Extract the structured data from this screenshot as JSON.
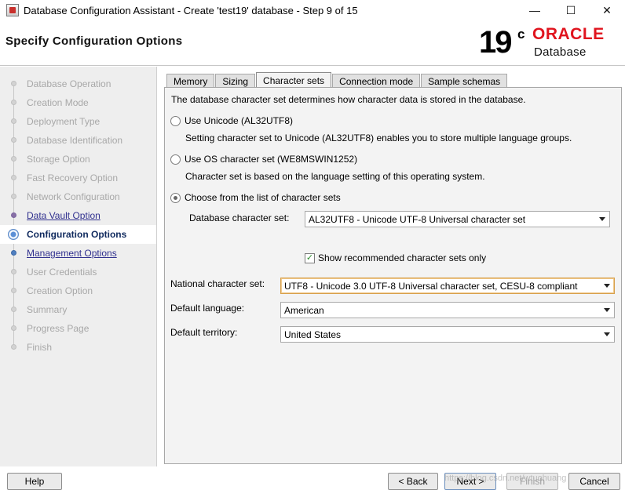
{
  "window": {
    "title": "Database Configuration Assistant - Create 'test19' database - Step 9 of 15",
    "minimize_glyph": "—",
    "maximize_glyph": "☐",
    "close_glyph": "✕"
  },
  "header": {
    "page_title": "Specify Configuration Options",
    "logo": {
      "version": "19",
      "version_sup": "c",
      "brand": "ORACLE",
      "product": "Database"
    }
  },
  "sidebar": {
    "steps": [
      {
        "label": "Database Operation",
        "state": "done"
      },
      {
        "label": "Creation Mode",
        "state": "done"
      },
      {
        "label": "Deployment Type",
        "state": "done"
      },
      {
        "label": "Database Identification",
        "state": "done"
      },
      {
        "label": "Storage Option",
        "state": "done"
      },
      {
        "label": "Fast Recovery Option",
        "state": "done"
      },
      {
        "label": "Network Configuration",
        "state": "done"
      },
      {
        "label": "Data Vault Option",
        "state": "link"
      },
      {
        "label": "Configuration Options",
        "state": "current"
      },
      {
        "label": "Management Options",
        "state": "link"
      },
      {
        "label": "User Credentials",
        "state": "pending"
      },
      {
        "label": "Creation Option",
        "state": "pending"
      },
      {
        "label": "Summary",
        "state": "pending"
      },
      {
        "label": "Progress Page",
        "state": "pending"
      },
      {
        "label": "Finish",
        "state": "pending"
      }
    ]
  },
  "tabs": [
    {
      "label": "Memory"
    },
    {
      "label": "Sizing"
    },
    {
      "label": "Character sets",
      "active": true
    },
    {
      "label": "Connection mode"
    },
    {
      "label": "Sample schemas"
    }
  ],
  "charset": {
    "description": "The database character set determines how character data is stored in the database.",
    "option_unicode": "Use Unicode (AL32UTF8)",
    "option_unicode_desc": "Setting character set to Unicode (AL32UTF8) enables you to store multiple language groups.",
    "option_os": "Use OS character set (WE8MSWIN1252)",
    "option_os_desc": "Character set is based on the language setting of this operating system.",
    "option_list": "Choose from the list of character sets",
    "selected_option": "list",
    "db_charset_label": "Database character set:",
    "db_charset_value": "AL32UTF8 - Unicode UTF-8 Universal character set",
    "show_recommended_label": "Show recommended character sets only",
    "show_recommended_checked": true,
    "national_label": "National character set:",
    "national_value": "UTF8 - Unicode 3.0 UTF-8 Universal character set, CESU-8 compliant",
    "language_label": "Default language:",
    "language_value": "American",
    "territory_label": "Default territory:",
    "territory_value": "United States"
  },
  "footer": {
    "help": "Help",
    "back": "< Back",
    "next": "Next >",
    "finish": "Finish",
    "cancel": "Cancel",
    "watermark": "https://blog.csdn.net/wtuohuang"
  }
}
